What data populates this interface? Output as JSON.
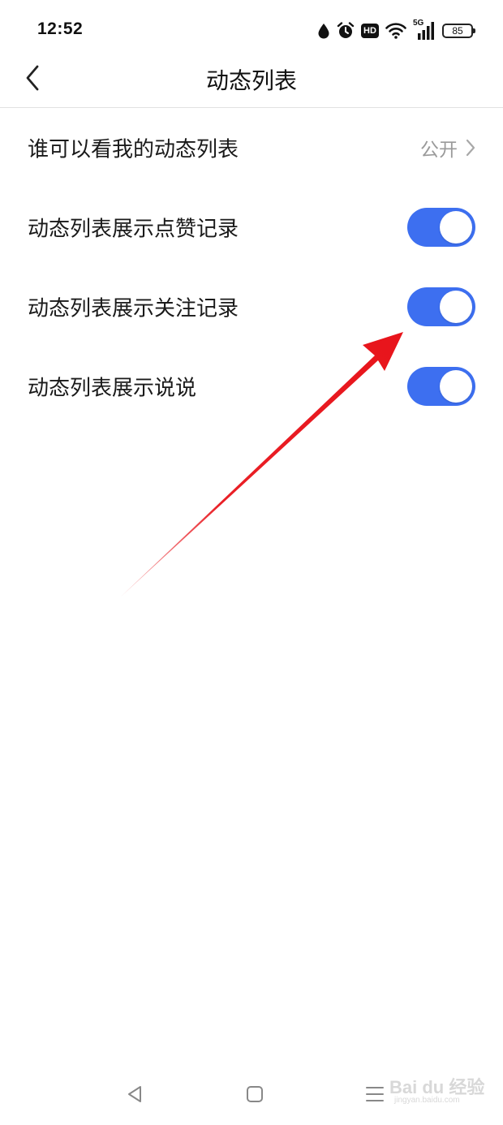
{
  "status_bar": {
    "time": "12:52",
    "network_label": "5G",
    "hd_label": "HD",
    "battery_level": "85",
    "icons": [
      "water-drop-icon",
      "alarm-icon",
      "hd-icon",
      "wifi-icon",
      "signal-icon",
      "battery-icon"
    ]
  },
  "header": {
    "title": "动态列表",
    "back_icon": "chevron-left-icon"
  },
  "settings": {
    "who_can_see": {
      "label": "谁可以看我的动态列表",
      "value": "公开",
      "icon": "chevron-right-icon"
    },
    "toggles": [
      {
        "label": "动态列表展示点赞记录",
        "enabled": true
      },
      {
        "label": "动态列表展示关注记录",
        "enabled": true
      },
      {
        "label": "动态列表展示说说",
        "enabled": true
      }
    ],
    "toggle_on_color": "#3d6ff0"
  },
  "annotation": {
    "arrow_color": "#e8141b",
    "icon": "red-arrow-icon"
  },
  "nav_bar": {
    "icons": [
      "back-triangle-icon",
      "home-square-icon",
      "menu-lines-icon"
    ]
  },
  "watermark": {
    "main": "Bai du 经验",
    "sub": "jingyan.baidu.com"
  }
}
